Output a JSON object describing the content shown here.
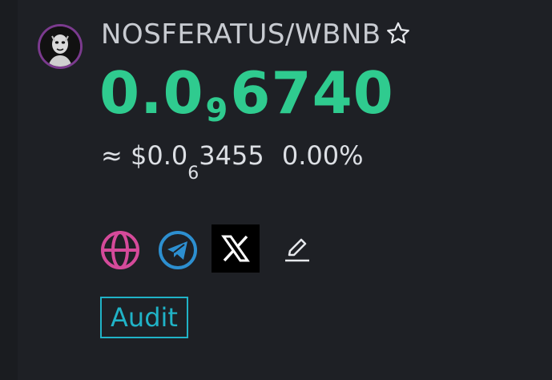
{
  "token": {
    "pair": "NOSFERATUS/WBNB",
    "avatar_icon": "nosferatu-avatar-icon",
    "favorite_icon": "star-outline-icon"
  },
  "price": {
    "lead": "0.0",
    "zero_count": "9",
    "digits": "6740",
    "color": "#2fcb8f"
  },
  "usd": {
    "approx": "≈",
    "lead": "$0.0",
    "zero_count": "6",
    "digits": "3455",
    "change": "0.00%"
  },
  "links": [
    {
      "name": "website",
      "icon": "globe-icon",
      "color": "#d54a9a"
    },
    {
      "name": "telegram",
      "icon": "telegram-icon",
      "color": "#2d8fd0"
    },
    {
      "name": "x",
      "icon": "x-logo-icon",
      "color": "#ffffff"
    },
    {
      "name": "edit",
      "icon": "pencil-icon",
      "color": "#e6e8ec"
    }
  ],
  "audit": {
    "label": "Audit",
    "color": "#20b3c7"
  }
}
